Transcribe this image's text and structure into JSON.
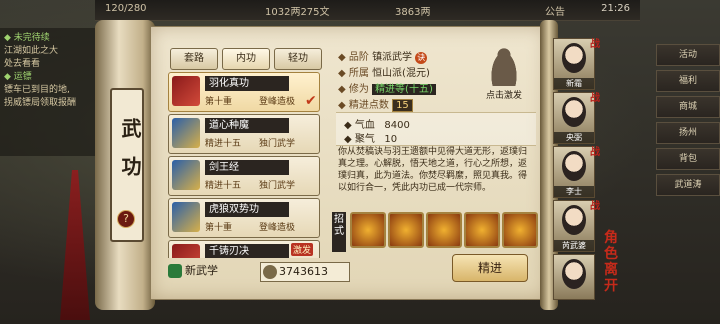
{
  "topbar": {
    "energy": "120/280",
    "money": "1032两275文",
    "ingot": "3863两",
    "notice": "公告",
    "clock": "21:26"
  },
  "quest": {
    "h1": "◆ 未完待续",
    "l1": "江湖如此之大",
    "l2": "处去看看",
    "h2": "◆ 运镖",
    "l3": "镖车已到目的地,",
    "l4": "拐威镖局领取报酬"
  },
  "rightmenu": [
    "活动",
    "福利",
    "商城",
    "扬州",
    "背包",
    "武道涛"
  ],
  "title": "武功",
  "tabs": [
    "套路",
    "内功",
    "轻功"
  ],
  "skills": [
    {
      "name": "羽化真功",
      "l1": "第十重",
      "l2": "登峰造极",
      "selected": true
    },
    {
      "name": "道心种魔",
      "l1": "精进十五",
      "l2": "独门武学"
    },
    {
      "name": "剑王经",
      "l1": "精进十五",
      "l2": "独门武学"
    },
    {
      "name": "虎狼双势功",
      "l1": "第十重",
      "l2": "登峰造极"
    },
    {
      "name": "千铸刃决",
      "l1": "",
      "l2": "",
      "tag": "激发"
    }
  ],
  "new_skill": "新武学",
  "points": "3743613",
  "info": {
    "rank_k": "◆ 品阶",
    "rank_v": "镇派武学",
    "rank_badge": "诀",
    "sect_k": "◆ 所属",
    "sect_v": "恒山派(混元)",
    "cult_k": "◆ 修为",
    "cult_v": "精进等(十五)",
    "pts_k": "◆ 精进点数",
    "pts_v": "15"
  },
  "meditate_caption": "点击激发",
  "stats": {
    "qixue_k": "◆ 气血",
    "qixue_v": "8400",
    "juqi_k": "◆ 聚气",
    "juqi_v": "10"
  },
  "description": "你从焚稿诀与羽王遗额中见得大道无形，返璞归真之理。心解脱，悟天地之道，行心之所想，返璞归真，此为道法。你焚尽羁縻，照见真我。得以如行合一，凭此内功已成一代宗师。",
  "zhaoshi": "招式",
  "jingjin": "精进",
  "portraits": [
    {
      "name": "新霜"
    },
    {
      "name": "央弼"
    },
    {
      "name": "李士"
    },
    {
      "name": "芮武婆"
    },
    {
      "name": ""
    }
  ],
  "side_text": "角色 离开"
}
